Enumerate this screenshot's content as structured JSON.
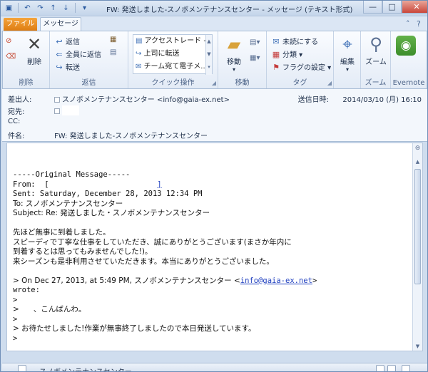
{
  "window": {
    "title": "FW: 発送しました-スノボメンテナンスセンター - メッセージ (テキスト形式)",
    "controls": {
      "minimize": "—",
      "maximize": "□",
      "close": "✕"
    }
  },
  "tabs": [
    {
      "label": "ファイル",
      "active": false
    },
    {
      "label": "メッセージ",
      "active": true
    }
  ],
  "ribbon": {
    "groups": {
      "delete": {
        "label": "削除",
        "delete_label": "削除"
      },
      "respond": {
        "label": "返信",
        "reply": "返信",
        "reply_all": "全員に返信",
        "forward": "転送"
      },
      "quicksteps": {
        "label": "クイック操作",
        "items": [
          "アクセストレード - ...",
          "上司に転送",
          "チーム宛て電子メ..."
        ]
      },
      "move": {
        "label": "移動",
        "move_label": "移動"
      },
      "tags": {
        "label": "タグ",
        "unread": "未読にする",
        "categorize": "分類",
        "followup": "フラグの設定"
      },
      "editing": {
        "edit_label": "編集"
      },
      "zoom": {
        "label": "ズーム",
        "zoom_label": "ズーム"
      },
      "evernote": {
        "label": "Evernote"
      }
    }
  },
  "header": {
    "from_label": "差出人:",
    "from_value": "スノボメンテナンスセンター <info@gaia-ex.net>",
    "to_label": "宛先:",
    "cc_label": "CC:",
    "subject_label": "件名:",
    "subject_value": "FW: 発送しました-スノボメンテナンスセンター",
    "sent_label": "送信日時:",
    "sent_value": "2014/03/10 (月) 16:10"
  },
  "body": {
    "original_message": "-----Original Message-----",
    "from_line": "From:  [",
    "from_line_end": "]",
    "sent_line": "Sent: Saturday, December 28, 2013 12:34 PM",
    "to_line": "To: スノボメンテナンスセンター",
    "subject_line": "Subject: Re: 発送しました・スノボメンテナンスセンター",
    "paragraph": [
      "先ほど無事に到着しました。",
      "スピーディで丁寧な仕事をしていただき、誠にありがとうございます(まさか年内に",
      "到着するとは思ってもみませんでした!)。",
      "来シーズンも是非利用させていただきます。本当にありがとうございました。"
    ],
    "quote_header": "> On Dec 27, 2013, at 5:49 PM, スノボメンテナンスセンター <",
    "quote_link": "info@gaia-ex.net",
    "quote_header_end": ">",
    "wrote": "wrote:",
    "q1": ">",
    "q2": ">      、こんばんわ。",
    "q3": ">",
    "q4": "> お待たせしました!作業が無事終了しましたので本日発送しています。",
    "q5": ">"
  },
  "people_pane": {
    "name": "スノボメンテナンスセンター"
  },
  "colors": {
    "accent_file_tab": "#de7d12",
    "ribbon_bg": "#e3ebf6",
    "link": "#1f3fbf"
  }
}
